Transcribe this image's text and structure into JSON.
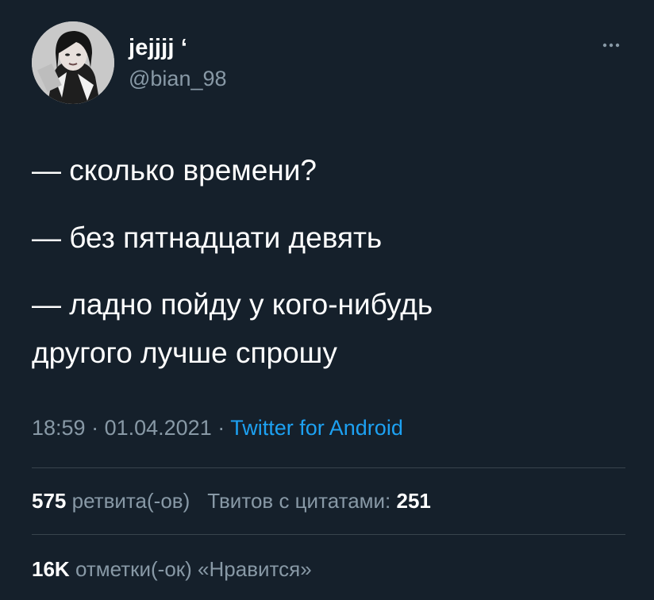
{
  "user": {
    "display_name": "jejjjj ‘",
    "handle": "@bian_98",
    "avatar_icon": "profile-photo"
  },
  "menu": {
    "more_icon": "ellipsis-icon"
  },
  "tweet": {
    "lines": [
      "— сколько времени?",
      "— без пятнадцати девять",
      "— ладно пойду у кого-нибудь",
      "другого лучше спрошу"
    ]
  },
  "meta": {
    "time": "18:59",
    "sep1": " · ",
    "date": "01.04.2021",
    "sep2": " · ",
    "source": "Twitter for Android"
  },
  "stats": {
    "retweets_count": "575",
    "retweets_label": "ретвита(-ов)",
    "quotes_label": "Твитов с цитатами:",
    "quotes_count": "251",
    "likes_count": "16K",
    "likes_label": "отметки(-ок) «Нравится»"
  },
  "colors": {
    "background": "#15202b",
    "text": "#ffffff",
    "secondary": "#8899a6",
    "link": "#1da1f2",
    "divider": "#38444d"
  }
}
